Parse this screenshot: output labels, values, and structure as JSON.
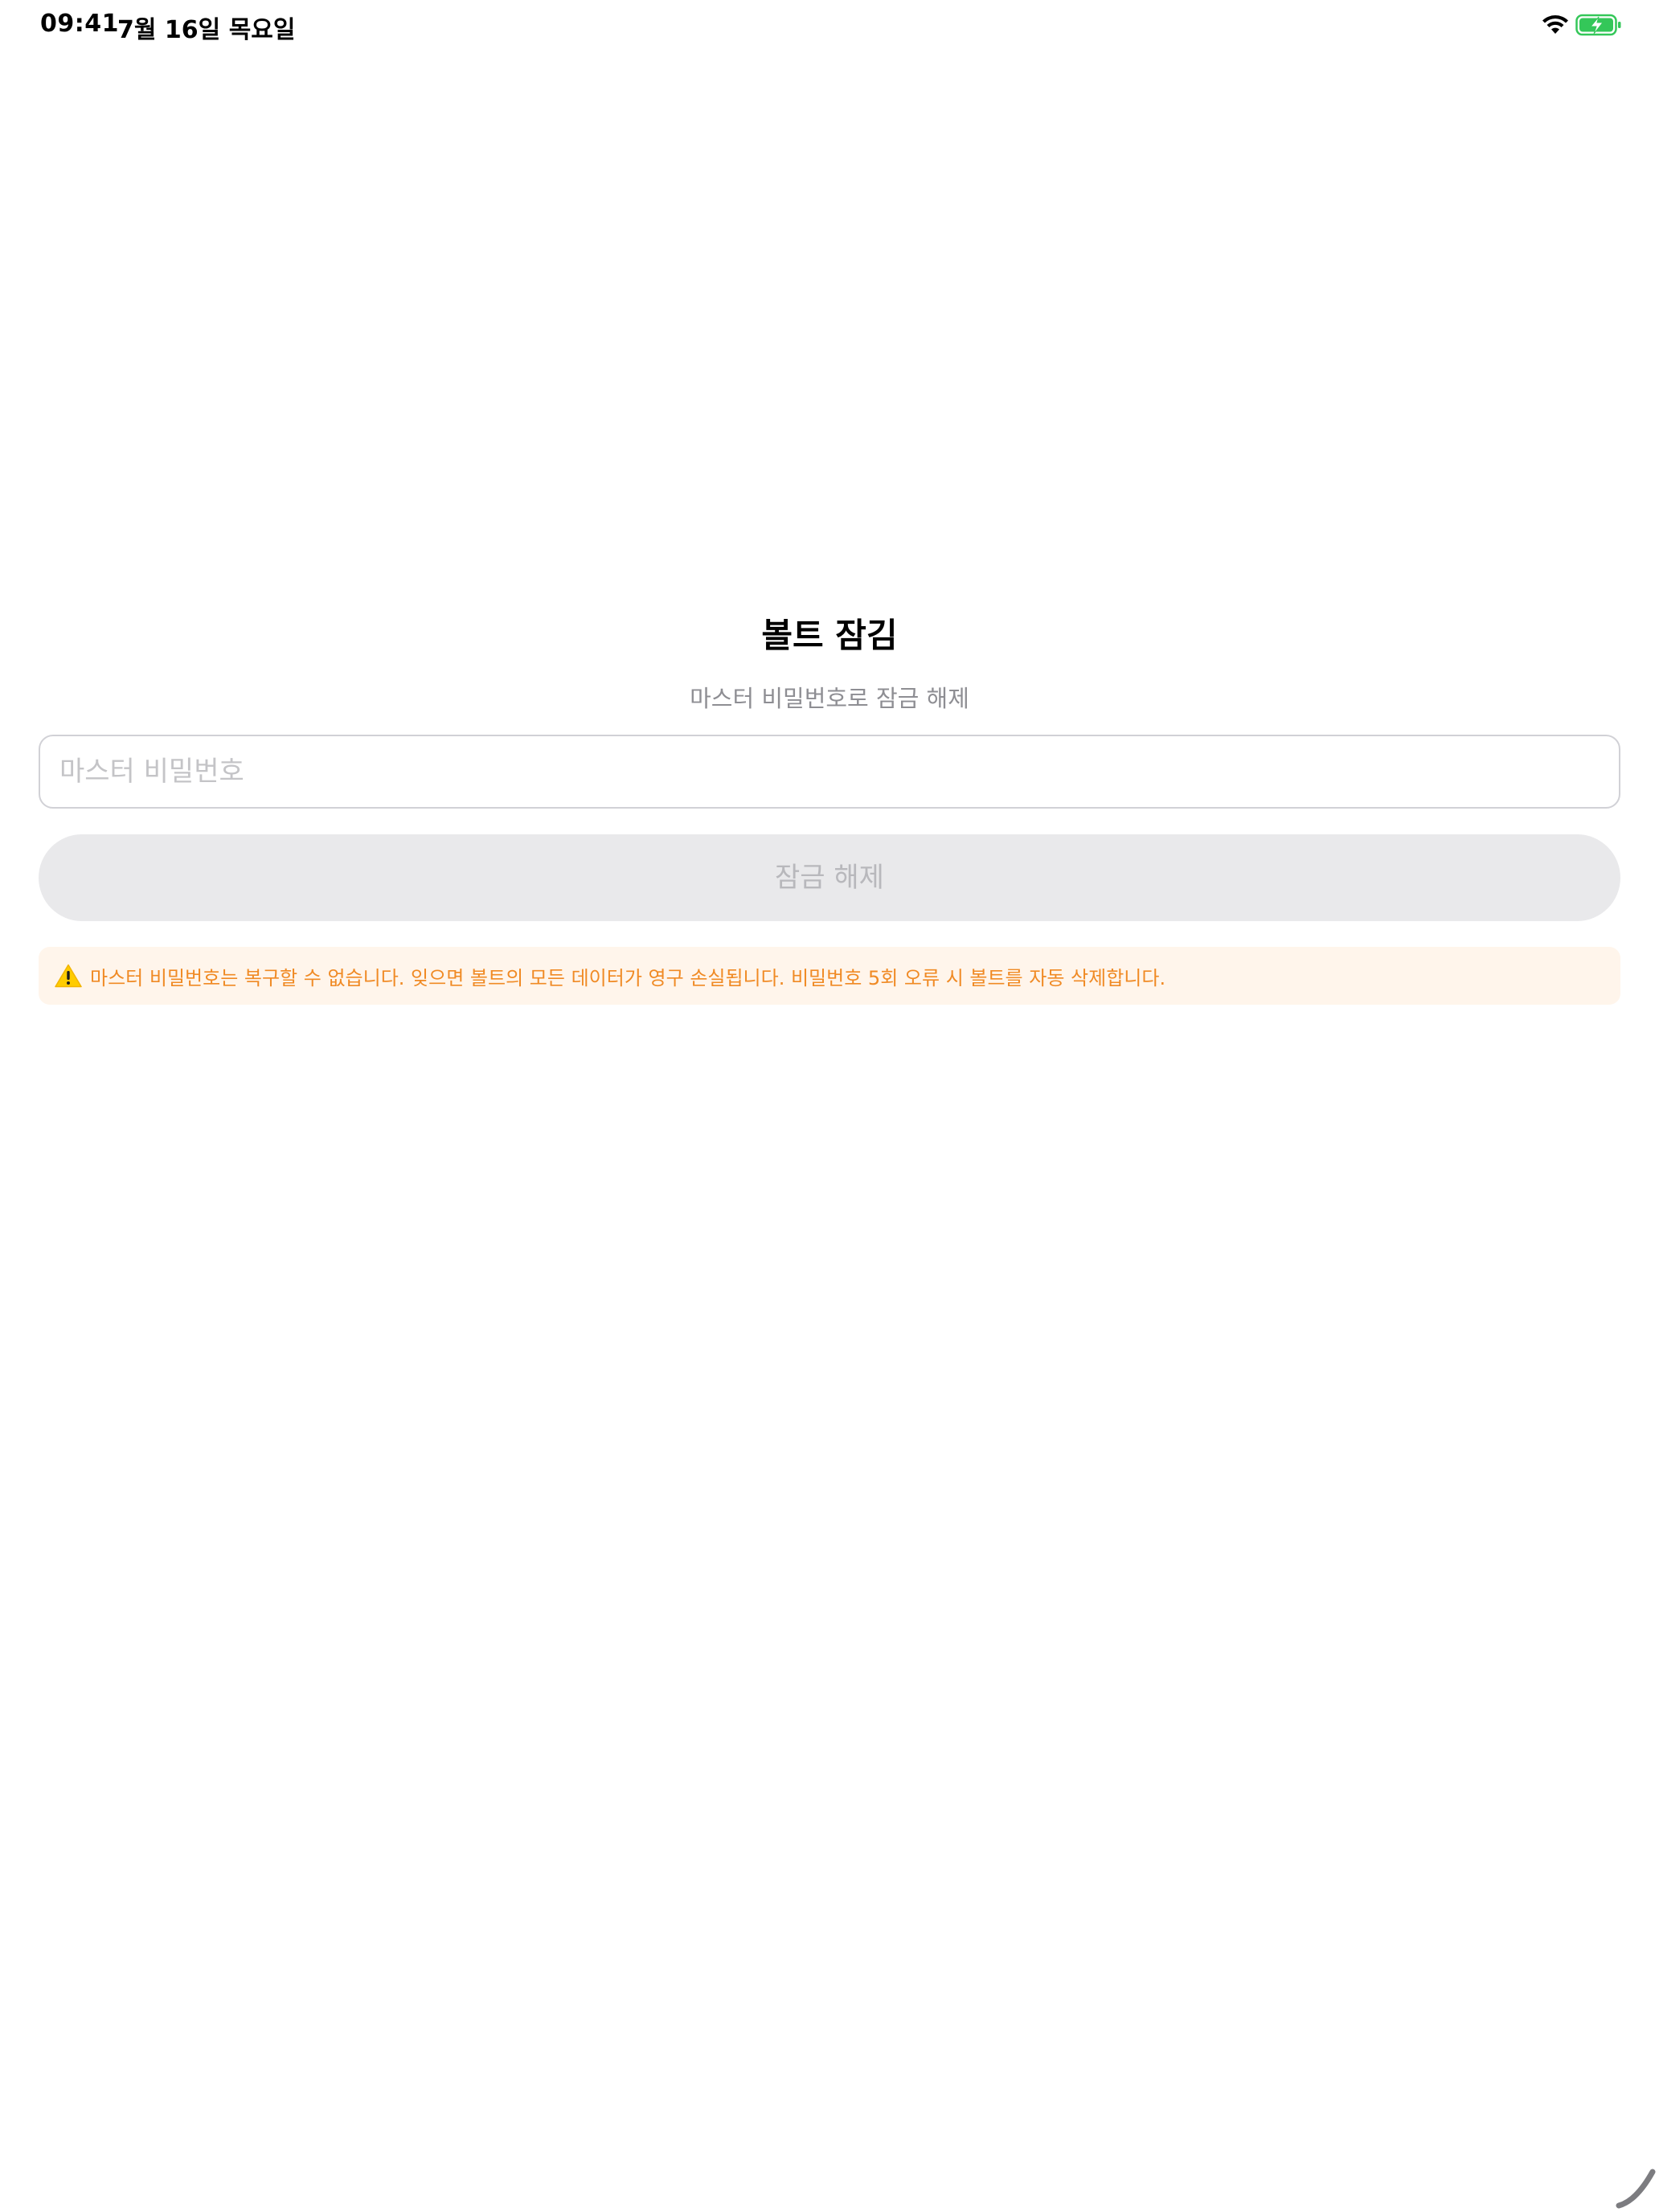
{
  "status_bar": {
    "time": "09:41",
    "date": "7월 16일 목요일",
    "wifi_icon": "wifi-icon",
    "battery_icon": "battery-charging-icon",
    "battery_color": "#34c759"
  },
  "lock_screen": {
    "title": "볼트 잠김",
    "subtitle": "마스터 비밀번호로 잠금 해제",
    "password_placeholder": "마스터 비밀번호",
    "unlock_label": "잠금 해제",
    "warning_icon": "warning-icon",
    "warning_text": "마스터 비밀번호는 복구할 수 없습니다. 잊으면 볼트의 모든 데이터가 영구 손실됩니다. 비밀번호 5회 오류 시 볼트를 자동 삭제합니다.",
    "warning_color": "#f08a24",
    "warning_background": "#fff5eb"
  }
}
